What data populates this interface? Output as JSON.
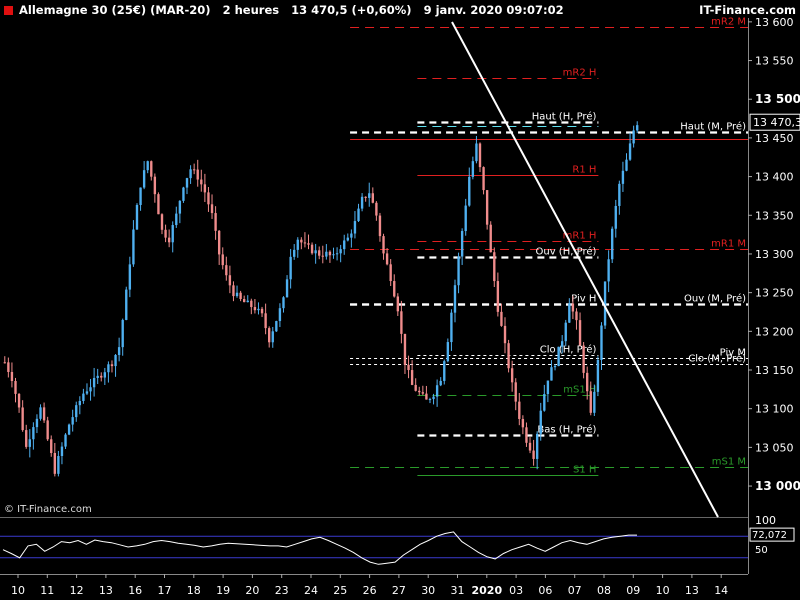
{
  "header": {
    "title": "Allemagne 30 (25€) (MAR-20)",
    "timeframe": "2 heures",
    "last": "13 470,5 (+0,60%)",
    "datetime": "9 janv. 2020 09:07:02"
  },
  "brand": "IT-Finance.com",
  "copyright": "© IT-Finance.com",
  "colors": {
    "up": "#4fb0f0",
    "down": "#f08c8c",
    "res": "#e02020",
    "sup": "#2a9a2a",
    "trend": "#ffffff",
    "rsi": "#3b3bd0"
  },
  "chart_data": [
    {
      "type": "candlestick",
      "ylim": [
        12960,
        13605
      ],
      "y_ticks": [
        "13 600",
        "13 550",
        "13 500",
        "13 450",
        "13 400",
        "13 350",
        "13 300",
        "13 250",
        "13 200",
        "13 150",
        "13 100",
        "13 050",
        "13 000"
      ],
      "y_tick_values": [
        13600,
        13550,
        13500,
        13450,
        13400,
        13350,
        13300,
        13250,
        13200,
        13150,
        13100,
        13050,
        13000
      ],
      "bold_ticks": [
        "13 500",
        "13 000"
      ],
      "last_price": "13 470,3",
      "last_price_value": 13470.3,
      "x_ticks": [
        "10",
        "11",
        "12",
        "13",
        "16",
        "17",
        "18",
        "19",
        "20",
        "23",
        "24",
        "25",
        "26",
        "27",
        "30",
        "31",
        "2020",
        "03",
        "06",
        "07",
        "08",
        "09",
        "10",
        "13",
        "14"
      ],
      "close_path": [
        [
          0,
          13160
        ],
        [
          2,
          13140
        ],
        [
          4,
          13100
        ],
        [
          6,
          13050
        ],
        [
          8,
          13080
        ],
        [
          10,
          13100
        ],
        [
          12,
          13060
        ],
        [
          14,
          13020
        ],
        [
          16,
          13050
        ],
        [
          18,
          13080
        ],
        [
          22,
          13120
        ],
        [
          26,
          13140
        ],
        [
          30,
          13160
        ],
        [
          32,
          13180
        ],
        [
          34,
          13250
        ],
        [
          36,
          13330
        ],
        [
          38,
          13390
        ],
        [
          40,
          13420
        ],
        [
          42,
          13380
        ],
        [
          44,
          13330
        ],
        [
          46,
          13320
        ],
        [
          48,
          13350
        ],
        [
          50,
          13390
        ],
        [
          52,
          13410
        ],
        [
          54,
          13400
        ],
        [
          56,
          13380
        ],
        [
          58,
          13350
        ],
        [
          60,
          13300
        ],
        [
          62,
          13270
        ],
        [
          64,
          13250
        ],
        [
          66,
          13240
        ],
        [
          68,
          13235
        ],
        [
          70,
          13230
        ],
        [
          72,
          13220
        ],
        [
          74,
          13190
        ],
        [
          76,
          13215
        ],
        [
          78,
          13240
        ],
        [
          80,
          13300
        ],
        [
          82,
          13320
        ],
        [
          84,
          13310
        ],
        [
          86,
          13305
        ],
        [
          88,
          13300
        ],
        [
          90,
          13300
        ],
        [
          92,
          13295
        ],
        [
          94,
          13310
        ],
        [
          96,
          13320
        ],
        [
          98,
          13340
        ],
        [
          100,
          13370
        ],
        [
          102,
          13380
        ],
        [
          104,
          13350
        ],
        [
          106,
          13300
        ],
        [
          108,
          13270
        ],
        [
          110,
          13230
        ],
        [
          112,
          13160
        ],
        [
          114,
          13130
        ],
        [
          116,
          13120
        ],
        [
          118,
          13110
        ],
        [
          120,
          13120
        ],
        [
          122,
          13140
        ],
        [
          124,
          13190
        ],
        [
          126,
          13260
        ],
        [
          128,
          13330
        ],
        [
          130,
          13400
        ],
        [
          132,
          13440
        ],
        [
          134,
          13380
        ],
        [
          136,
          13300
        ],
        [
          138,
          13230
        ],
        [
          140,
          13180
        ],
        [
          142,
          13130
        ],
        [
          144,
          13090
        ],
        [
          146,
          13060
        ],
        [
          148,
          13040
        ],
        [
          150,
          13100
        ],
        [
          152,
          13140
        ],
        [
          154,
          13160
        ],
        [
          156,
          13190
        ],
        [
          158,
          13240
        ],
        [
          160,
          13210
        ],
        [
          162,
          13150
        ],
        [
          164,
          13090
        ],
        [
          166,
          13160
        ],
        [
          168,
          13260
        ],
        [
          170,
          13330
        ],
        [
          172,
          13390
        ],
        [
          174,
          13420
        ],
        [
          176,
          13460
        ],
        [
          177,
          13470
        ]
      ],
      "levels": [
        {
          "label": "mR2 M",
          "value": 13594,
          "color": "#e02020",
          "style": "dash",
          "x1": 0.52,
          "x2": 1.0,
          "align": "end"
        },
        {
          "label": "mR2 H",
          "value": 13528,
          "color": "#e02020",
          "style": "dash",
          "x1": 0.62,
          "x2": 0.8,
          "align": "end"
        },
        {
          "label": "Haut (H, Pré)",
          "value": 13471,
          "color": "#ffffff",
          "style": "dashw",
          "x1": 0.62,
          "x2": 0.8,
          "align": "end"
        },
        {
          "label": "",
          "value": 13466,
          "color": "#60e0f0",
          "style": "dash",
          "x1": 0.62,
          "x2": 0.8,
          "align": "end"
        },
        {
          "label": "Haut (M, Pré)",
          "value": 13457,
          "color": "#ffffff",
          "style": "dashw",
          "x1": 0.52,
          "x2": 1.0,
          "align": "end"
        },
        {
          "label": "",
          "value": 13449,
          "color": "#e02020",
          "style": "solid",
          "x1": 0.52,
          "x2": 1.0,
          "align": "end"
        },
        {
          "label": "R1 H",
          "value": 13402,
          "color": "#e02020",
          "style": "solid",
          "x1": 0.62,
          "x2": 0.8,
          "align": "end"
        },
        {
          "label": "mR1 H",
          "value": 13317,
          "color": "#e02020",
          "style": "dash",
          "x1": 0.62,
          "x2": 0.8,
          "align": "end"
        },
        {
          "label": "mR1 M",
          "value": 13307,
          "color": "#e02020",
          "style": "dash",
          "x1": 0.52,
          "x2": 1.0,
          "align": "end"
        },
        {
          "label": "Ouv (H, Pré)",
          "value": 13296,
          "color": "#ffffff",
          "style": "dashw",
          "x1": 0.62,
          "x2": 0.8,
          "align": "end"
        },
        {
          "label": "Piv H",
          "value": 13235,
          "color": "#ffffff",
          "style": "dashw",
          "x1": 0.52,
          "x2": 0.8,
          "align": "end"
        },
        {
          "label": "Ouv (M, Pré)",
          "value": 13235,
          "color": "#ffffff",
          "style": "dashw",
          "x1": 0.52,
          "x2": 1.0,
          "align": "end"
        },
        {
          "label": "Clo (H, Pré)",
          "value": 13170,
          "color": "#ffffff",
          "style": "dot",
          "x1": 0.62,
          "x2": 0.8,
          "align": "end"
        },
        {
          "label": "Piv M",
          "value": 13165,
          "color": "#ffffff",
          "style": "dot",
          "x1": 0.52,
          "x2": 1.0,
          "align": "end"
        },
        {
          "label": "Clo (M, Pré)",
          "value": 13158,
          "color": "#ffffff",
          "style": "dot",
          "x1": 0.52,
          "x2": 1.0,
          "align": "end"
        },
        {
          "label": "mS1 H",
          "value": 13118,
          "color": "#2a9a2a",
          "style": "dash",
          "x1": 0.62,
          "x2": 0.8,
          "align": "end"
        },
        {
          "label": "Bas (H, Pré)",
          "value": 13066,
          "color": "#ffffff",
          "style": "dashw",
          "x1": 0.62,
          "x2": 0.8,
          "align": "end"
        },
        {
          "label": "mS1 M",
          "value": 13025,
          "color": "#2a9a2a",
          "style": "dash",
          "x1": 0.52,
          "x2": 1.0,
          "align": "end"
        },
        {
          "label": "S1 H",
          "value": 13014,
          "color": "#2a9a2a",
          "style": "solid",
          "x1": 0.62,
          "x2": 0.8,
          "align": "end"
        }
      ]
    },
    {
      "type": "line",
      "name": "RSI",
      "ylim": [
        0,
        100
      ],
      "y_ticks": [
        "100",
        "50"
      ],
      "last_value": "72,072",
      "bands": [
        70,
        30
      ],
      "values": [
        45,
        38,
        30,
        52,
        55,
        42,
        50,
        60,
        58,
        62,
        55,
        63,
        60,
        58,
        54,
        50,
        52,
        55,
        60,
        62,
        60,
        57,
        55,
        53,
        50,
        52,
        55,
        57,
        56,
        55,
        54,
        53,
        52,
        52,
        50,
        55,
        60,
        65,
        68,
        62,
        55,
        48,
        40,
        30,
        22,
        18,
        20,
        22,
        35,
        45,
        55,
        62,
        70,
        75,
        78,
        60,
        50,
        40,
        32,
        28,
        38,
        45,
        50,
        55,
        48,
        42,
        50,
        58,
        62,
        58,
        55,
        60,
        65,
        68,
        70,
        72,
        72
      ]
    }
  ]
}
